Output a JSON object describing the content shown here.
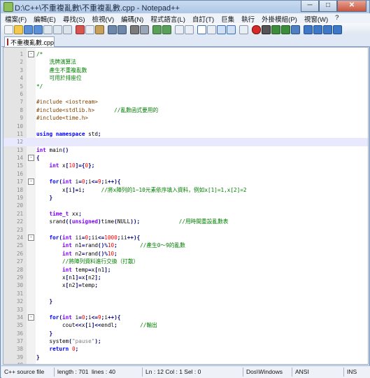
{
  "window": {
    "title": "D:\\C++\\不重複亂數\\不重複亂數.cpp - Notepad++",
    "minimize_glyph": "─",
    "maximize_glyph": "□",
    "close_glyph": "✕"
  },
  "menu": [
    {
      "key": "file",
      "label": "檔案(F)"
    },
    {
      "key": "edit",
      "label": "編輯(E)"
    },
    {
      "key": "search",
      "label": "尋找(S)"
    },
    {
      "key": "view",
      "label": "檢視(V)"
    },
    {
      "key": "encoding",
      "label": "編碼(N)"
    },
    {
      "key": "language",
      "label": "程式語言(L)"
    },
    {
      "key": "settings",
      "label": "自訂(T)"
    },
    {
      "key": "macro",
      "label": "巨集"
    },
    {
      "key": "run",
      "label": "執行"
    },
    {
      "key": "plugins",
      "label": "外掛模組(P)"
    },
    {
      "key": "window",
      "label": "視窗(W)"
    },
    {
      "key": "help",
      "label": "?"
    }
  ],
  "tab": {
    "label": "不重複亂數.cpp"
  },
  "editor": {
    "current_line": 12,
    "lines": [
      {
        "n": "1",
        "fold": "-",
        "text": "/*"
      },
      {
        "n": "2",
        "fold": "",
        "text": "    洗牌演算法"
      },
      {
        "n": "3",
        "fold": "",
        "text": "    產生不重複亂數"
      },
      {
        "n": "4",
        "fold": "",
        "text": "    可用於排座位"
      },
      {
        "n": "5",
        "fold": "",
        "text": "*/"
      },
      {
        "n": "6",
        "fold": "",
        "text": ""
      },
      {
        "n": "7",
        "fold": "",
        "text": "#include <iostream>"
      },
      {
        "n": "8",
        "fold": "",
        "text": "#include<stdlib.h>      //亂數函式要用的"
      },
      {
        "n": "9",
        "fold": "",
        "text": "#include<time.h>"
      },
      {
        "n": "10",
        "fold": "",
        "text": ""
      },
      {
        "n": "11",
        "fold": "",
        "text": "using namespace std;"
      },
      {
        "n": "12",
        "fold": "",
        "text": ""
      },
      {
        "n": "13",
        "fold": "",
        "text": "int main()"
      },
      {
        "n": "14",
        "fold": "-",
        "text": "{"
      },
      {
        "n": "15",
        "fold": "",
        "text": "    int x[10]={0};"
      },
      {
        "n": "16",
        "fold": "",
        "text": ""
      },
      {
        "n": "17",
        "fold": "-",
        "text": "    for(int i=0;i<=9;i++){"
      },
      {
        "n": "18",
        "fold": "",
        "text": "        x[i]=i;     //將x陣列的1~10元素依序填入資料，例如x[1]=1,x[2]=2"
      },
      {
        "n": "19",
        "fold": "",
        "text": "    }"
      },
      {
        "n": "20",
        "fold": "",
        "text": ""
      },
      {
        "n": "21",
        "fold": "",
        "text": "    time_t xx;"
      },
      {
        "n": "22",
        "fold": "",
        "text": "    srand((unsigned)time(NULL));            //用時間重設亂數表"
      },
      {
        "n": "23",
        "fold": "",
        "text": ""
      },
      {
        "n": "24",
        "fold": "-",
        "text": "    for(int ii=0;ii<=1000;ii++){"
      },
      {
        "n": "25",
        "fold": "",
        "text": "        int n1=rand()%10;       //產生0～9的亂數"
      },
      {
        "n": "26",
        "fold": "",
        "text": "        int n2=rand()%10;"
      },
      {
        "n": "27",
        "fold": "",
        "text": "        //將陣列資料進行交換（打散）"
      },
      {
        "n": "28",
        "fold": "",
        "text": "        int temp=x[n1];"
      },
      {
        "n": "29",
        "fold": "",
        "text": "        x[n1]=x[n2];"
      },
      {
        "n": "30",
        "fold": "",
        "text": "        x[n2]=temp;"
      },
      {
        "n": "31",
        "fold": "",
        "text": ""
      },
      {
        "n": "32",
        "fold": "",
        "text": "    }"
      },
      {
        "n": "33",
        "fold": "",
        "text": ""
      },
      {
        "n": "34",
        "fold": "-",
        "text": "    for(int i=0;i<=9;i++){"
      },
      {
        "n": "35",
        "fold": "",
        "text": "        cout<<x[i]<<endl;       //輸出"
      },
      {
        "n": "36",
        "fold": "",
        "text": "    }"
      },
      {
        "n": "37",
        "fold": "",
        "text": "    system(\"pause\");"
      },
      {
        "n": "38",
        "fold": "",
        "text": "    return 0;"
      },
      {
        "n": "39",
        "fold": "",
        "text": "}"
      },
      {
        "n": "40",
        "fold": "",
        "text": ""
      }
    ]
  },
  "status": {
    "language": "C++ source file",
    "length": "length : 701",
    "lines": "lines : 40",
    "position": "Ln : 12   Col : 1   Sel : 0",
    "eol": "Dos\\Windows",
    "encoding": "ANSI",
    "mode": "INS"
  },
  "colors": {
    "comment": "#008000",
    "keyword": "#0000ff",
    "preprocessor": "#804000",
    "number": "#ff0000",
    "operator": "#000080",
    "type": "#8000ff",
    "string": "#808080",
    "current_line": "#e8e8ff"
  }
}
